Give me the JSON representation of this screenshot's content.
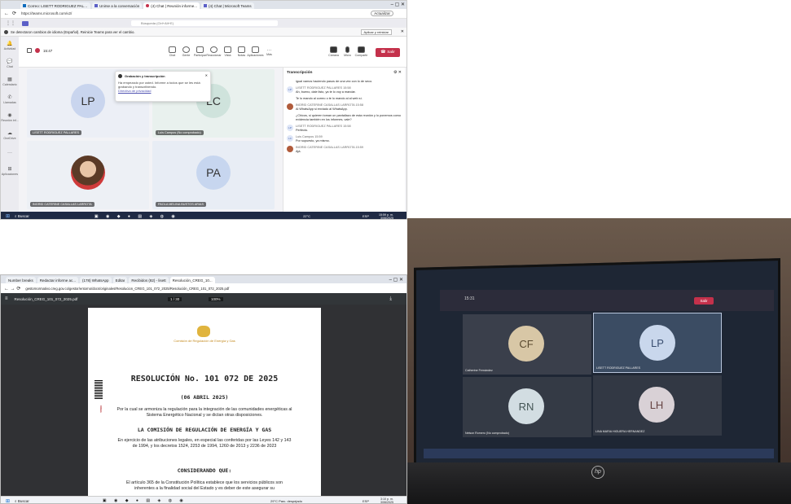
{
  "teams_browser": {
    "tabs": [
      "Correo: LISETT RODRIGUEZ PALL...",
      "Unirse a la conversación",
      "(4) Chat | Reunión informe...",
      "(4) Chat | Microsoft Teams"
    ],
    "url": "https://teams.microsoft.com/v2/",
    "update_label": "Actualizar",
    "search_placeholder": "Búsqueda (Ctrl+Alt+E)",
    "notice": "Se detectaron cambios de idioma (Español). Reinicie Teams para ver el cambio.",
    "notice_action": "Aplicar y reiniciar",
    "meeting_time": "15:47",
    "rail": [
      "Actividad",
      "Chat",
      "Calendario",
      "Llamadas",
      "Reunión inf...",
      "OneDrive",
      "Aplicaciones"
    ],
    "toolbar": [
      "Chat",
      "Gente",
      "Participar",
      "Reaccionar",
      "Vista",
      "Notas",
      "Aplicaciones",
      "Más",
      "Cámara",
      "Micro",
      "Compartir"
    ],
    "leave_label": "Salir",
    "popup_title": "Grabación y transcripción",
    "popup_text": "Ha empezado por usted. Informe a todos que se les está grabando y transcribiendo.",
    "popup_link": "Directiva de privacidad",
    "tiles": [
      {
        "initials": "LP",
        "name": "LISETT RODRIGUEZ PALLARES",
        "bg": "#e9edf7"
      },
      {
        "initials": "LC",
        "name": "Luis Campos (No comprobado)",
        "bg": "#e7f0ec"
      },
      {
        "initials": "",
        "name": "INGRID CATERINE CASALLAS LARROTA",
        "bg": "#eaeef3"
      },
      {
        "initials": "PA",
        "name": "PAOLA MELINA BUSTOS ARIAS",
        "bg": "#e8edf5"
      }
    ],
    "transcript_title": "Transcripción",
    "transcript": [
      {
        "who": "",
        "time": "",
        "text": "igual vamos haciendo pasos de una vez con lo de seco."
      },
      {
        "who": "LISETT RODRIGUEZ PALLARES",
        "time": "15:58",
        "text": "Ah, bueno, dale listo, ya te lo voy a mandar."
      },
      {
        "who": "",
        "time": "",
        "text": "Te lo mando al correo o te lo mando al al web sí."
      },
      {
        "who": "INGRID CATERINE CASALLAS LARROTA",
        "time": "15:58",
        "text": "Al WhatsApp si enviado al WhatsApp."
      },
      {
        "who": "",
        "time": "",
        "text": "¿Chicos, si quieren toman un pantallazo de esta reunión y lo ponemos como evidencia también en los informes, vale?"
      },
      {
        "who": "LISETT RODRIGUEZ PALLARES",
        "time": "15:58",
        "text": "Perfecto."
      },
      {
        "who": "Luis Campos",
        "time": "15:59",
        "text": "Por supuesto, ya mismo."
      },
      {
        "who": "INGRID CATERINE CASALLAS LARROTA",
        "time": "15:59",
        "text": "Ajá."
      }
    ],
    "taskbar": {
      "search": "Buscar",
      "weather": "22°C",
      "lang": "ESP",
      "time": "15:59 p. m.",
      "date": "3/06/2025"
    }
  },
  "pdf_browser": {
    "tabs": [
      "Number breaks",
      "Redactar informe ac...",
      "(178) WhatsApp",
      "Editar",
      "Recibidos (82) - lisett",
      "Resolución_CREG_10..."
    ],
    "url": "gestornormativo.creg.gov.co/gestor/entorno/docs/originales/Resolucion_CREG_101_072_2025/Resolución_CREG_101_072_2025.pdf",
    "file": "Resolución_CREG_101_072_2025.pdf",
    "page": "1 / 30",
    "zoom": "100%",
    "org": "Comisión de Regulación de Energía y Gas",
    "title": "RESOLUCIÓN No. 101 072 DE 2025",
    "date": "(06 ABRIL 2025)",
    "summary": "Por la cual se armoniza la regulación para la integración de las comunidades energéticas al Sistema Energético Nacional y se dictan otras disposiciones.",
    "heading": "LA COMISIÓN DE REGULACIÓN DE ENERGÍA Y GAS",
    "body": "En ejercicio de las atribuciones legales, en especial las conferidas por las Leyes 142 y 143 de 1994, y los decretos 1524, 2253 de 1994, 1260 de 2013 y 2236 de 2023",
    "considerando": "CONSIDERANDO QUE:",
    "para": "El artículo 365 de la Constitución Política establece que los servicios públicos son inherentes a la finalidad social del Estado y es deber de este asegurar su",
    "side_label": "CREG",
    "taskbar": {
      "search": "Buscar",
      "weather": "29°C Parc. despejado",
      "lang": "ESP",
      "time": "3:10 p. m.",
      "date": "3/06/2025"
    }
  },
  "photo": {
    "time": "15:31",
    "leave": "Salir",
    "tiles": [
      {
        "initials": "CF",
        "name": "Catherine Fernández"
      },
      {
        "initials": "LP",
        "name": "LISETT RODRIGUEZ PALLARES"
      },
      {
        "initials": "RN",
        "name": "Nelson Romero (No comprobado)"
      },
      {
        "initials": "LH",
        "name": "LINA MARIA HIGUERA HERNANDEZ"
      }
    ],
    "logo": "hp"
  }
}
